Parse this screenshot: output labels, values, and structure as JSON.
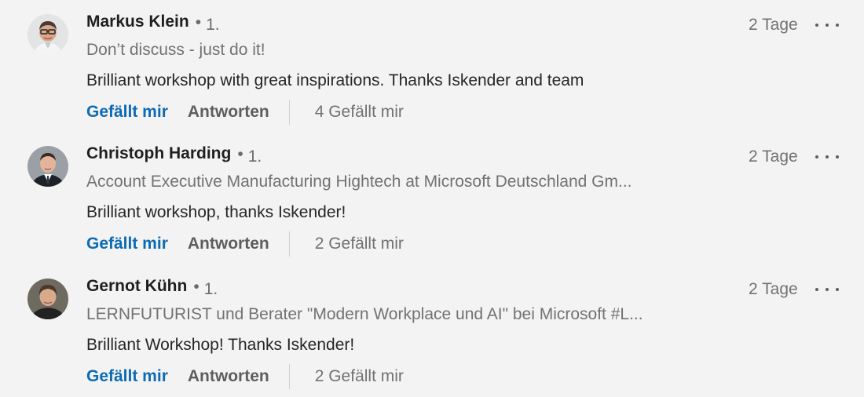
{
  "comments": [
    {
      "author": "Markus Klein",
      "bullet": "•",
      "degree": "1.",
      "headline": "Don’t discuss - just do it!",
      "text": "Brilliant workshop with great inspirations. Thanks Iskender and team",
      "time": "2 Tage",
      "like_label": "Gefällt mir",
      "reply_label": "Antworten",
      "like_count": "4 Gefällt mir"
    },
    {
      "author": "Christoph Harding",
      "bullet": "•",
      "degree": "1.",
      "headline": "Account Executive Manufacturing Hightech at Microsoft Deutschland Gm...",
      "text": "Brilliant workshop, thanks Iskender!",
      "time": "2 Tage",
      "like_label": "Gefällt mir",
      "reply_label": "Antworten",
      "like_count": "2 Gefällt mir"
    },
    {
      "author": "Gernot Kühn",
      "bullet": "•",
      "degree": "1.",
      "headline": "LERNFUTURIST und Berater \"Modern Workplace und AI\" bei Microsoft #L...",
      "text": "Brilliant Workshop! Thanks Iskender!",
      "time": "2 Tage",
      "like_label": "Gefällt mir",
      "reply_label": "Antworten",
      "like_count": "2 Gefällt mir"
    }
  ],
  "icons": {
    "more": "more-horizontal-icon"
  },
  "colors": {
    "background": "#f3f3f3",
    "accent": "#0d6bb3"
  }
}
